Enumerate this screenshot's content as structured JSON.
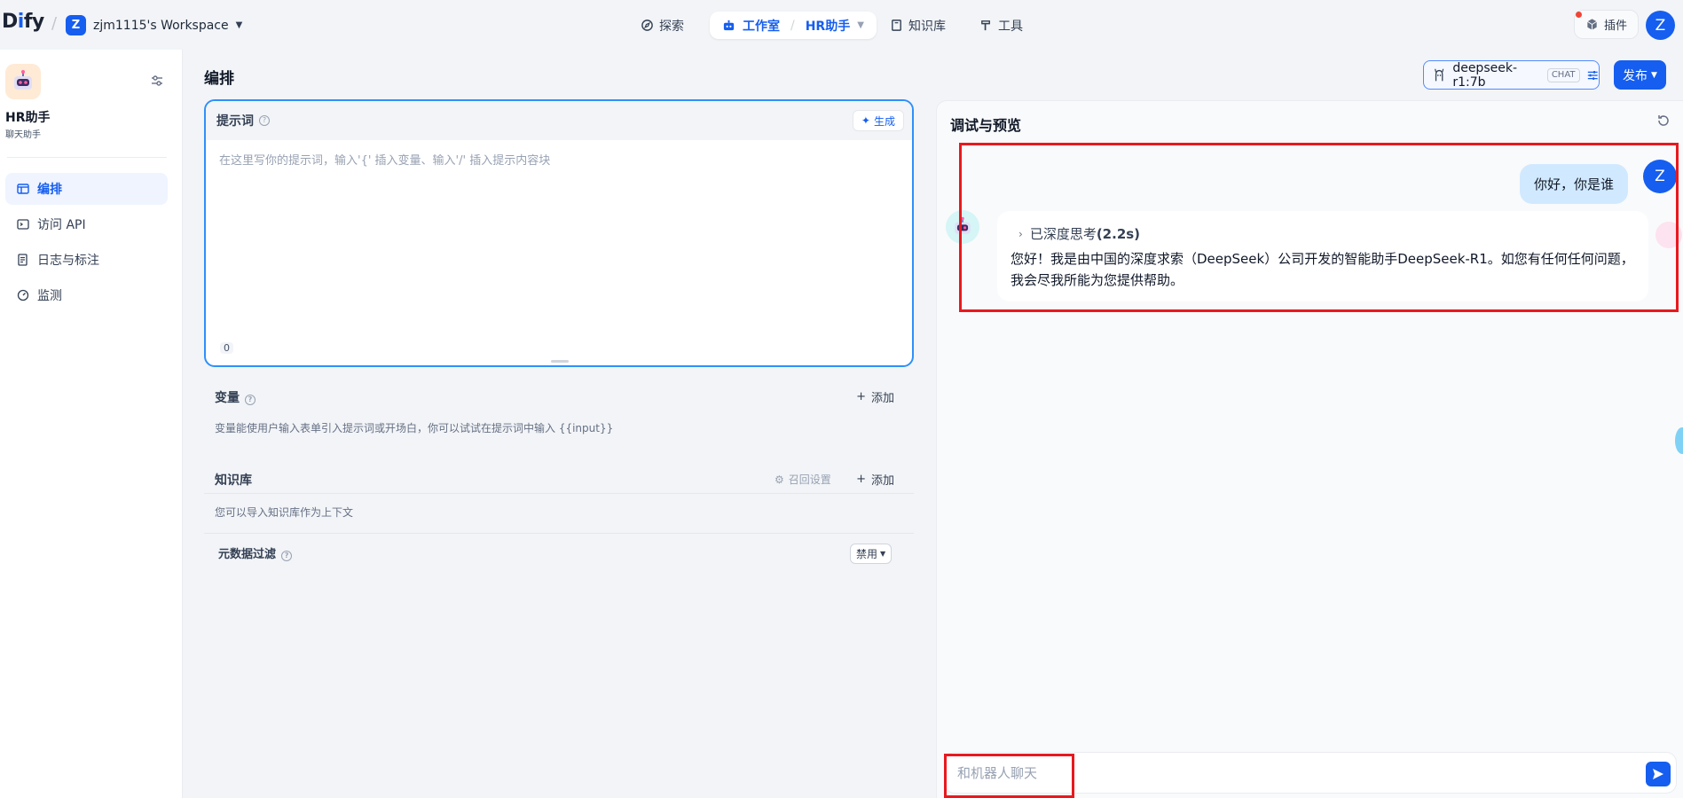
{
  "brand": {
    "logo": "Dify"
  },
  "workspace": {
    "avatar_letter": "Z",
    "name": "zjm1115's Workspace"
  },
  "nav": {
    "explore": "探索",
    "studio": "工作室",
    "current_app": "HR助手",
    "knowledge": "知识库",
    "tools": "工具"
  },
  "header_right": {
    "plugins": "插件",
    "user_letter": "Z"
  },
  "sidebar": {
    "app_name": "HR助手",
    "app_type": "聊天助手",
    "items": [
      {
        "label": "编排",
        "icon": "layout-icon"
      },
      {
        "label": "访问 API",
        "icon": "terminal-icon"
      },
      {
        "label": "日志与标注",
        "icon": "file-list-icon"
      },
      {
        "label": "监测",
        "icon": "dashboard-icon"
      }
    ]
  },
  "main": {
    "title": "编排",
    "model": {
      "name": "deepseek-r1:7b",
      "mode": "CHAT"
    },
    "publish": "发布"
  },
  "prompt": {
    "title": "提示词",
    "generate": "生成",
    "placeholder": "在这里写你的提示词，输入'{' 插入变量、输入'/' 插入提示内容块",
    "value": "",
    "char_count": "0"
  },
  "variables": {
    "title": "变量",
    "add": "添加",
    "desc": "变量能使用户输入表单引入提示词或开场白，你可以试试在提示词中输入 {{input}}"
  },
  "knowledge": {
    "title": "知识库",
    "recall": "召回设置",
    "add": "添加",
    "desc": "您可以导入知识库作为上下文",
    "metadata_filter": "元数据过滤",
    "filter_value": "禁用"
  },
  "debug": {
    "title": "调试与预览",
    "user_message": "你好，你是谁",
    "user_letter": "Z",
    "thinking_label": "已深度思考",
    "thinking_time": "(2.2s)",
    "answer": "您好！我是由中国的深度求索（DeepSeek）公司开发的智能助手DeepSeek-R1。如您有任何任何问题，我会尽我所能为您提供帮助。",
    "input_placeholder": "和机器人聊天"
  },
  "colors": {
    "accent": "#155eef",
    "highlight": "#e8191e",
    "user_bubble": "#d1e9ff"
  }
}
